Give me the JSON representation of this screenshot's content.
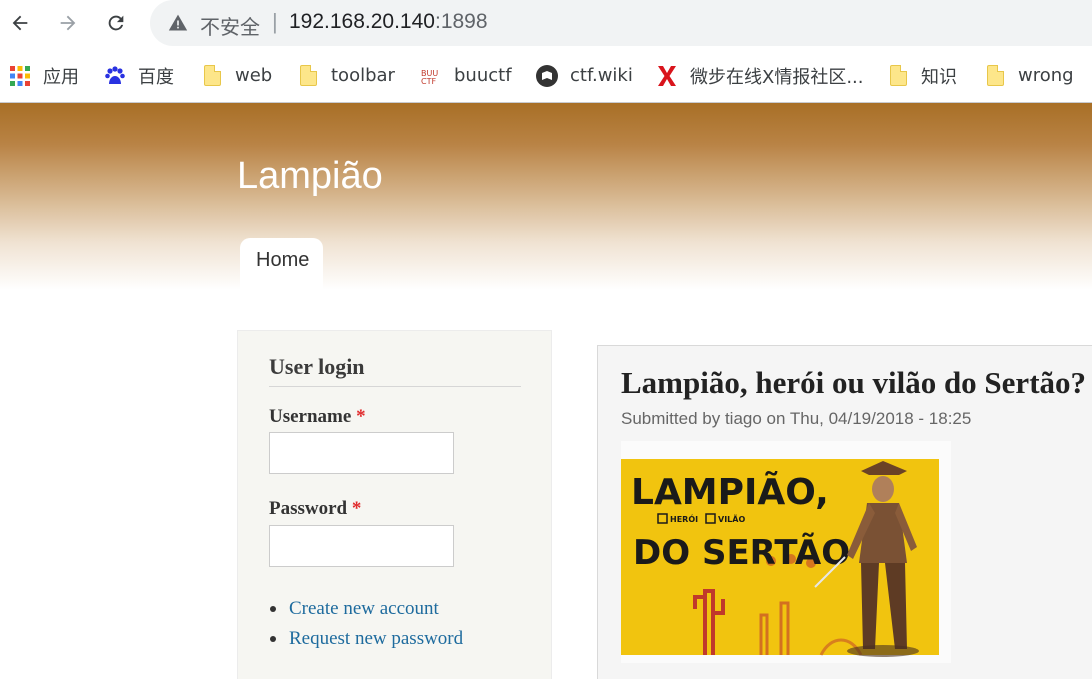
{
  "browser": {
    "back_icon": "arrow-left-icon",
    "forward_icon": "arrow-right-icon",
    "reload_icon": "reload-icon",
    "security_icon": "warning-triangle-icon",
    "security_label": "不安全",
    "address_separator": "|",
    "address_host": "192.168.20.140",
    "address_port": ":1898"
  },
  "bookmarks": [
    {
      "label": "应用",
      "icon": "apps-grid-icon"
    },
    {
      "label": "百度",
      "icon": "baidu-paw-icon"
    },
    {
      "label": "web",
      "icon": "folder-icon"
    },
    {
      "label": "toolbar",
      "icon": "folder-icon"
    },
    {
      "label": "buuctf",
      "icon": "buuctf-icon"
    },
    {
      "label": "ctf.wiki",
      "icon": "ctf-wiki-icon"
    },
    {
      "label": "微步在线X情报社区...",
      "icon": "threatbook-x-icon"
    },
    {
      "label": "知识",
      "icon": "folder-icon"
    },
    {
      "label": "wrong",
      "icon": "folder-icon"
    }
  ],
  "site": {
    "name": "Lampião",
    "nav": {
      "home_label": "Home"
    }
  },
  "login_block": {
    "title": "User login",
    "username_label": "Username",
    "password_label": "Password",
    "required_mark": "*",
    "username_value": "",
    "password_value": "",
    "links": [
      "Create new account",
      "Request new password"
    ]
  },
  "article": {
    "title": "Lampião, herói ou vilão do Sertão?",
    "meta": "Submitted by tiago on Thu, 04/19/2018 - 18:25",
    "image": {
      "line1": "LAMPIÃO,",
      "option1": "HERÓI",
      "option2": "VILÃO",
      "line2": "DO SERTÃO"
    }
  },
  "colors": {
    "header_top": "#a86f26",
    "link": "#1e6b9e",
    "required": "#e0282a",
    "poster_yellow": "#f1c40f"
  }
}
